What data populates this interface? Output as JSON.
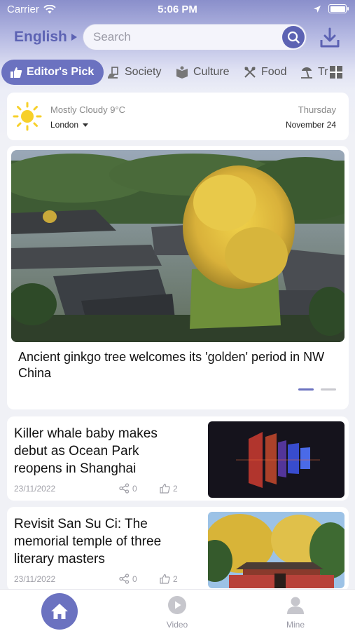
{
  "status_bar": {
    "carrier": "Carrier",
    "time": "5:06 PM"
  },
  "header": {
    "language": "English",
    "search_placeholder": "Search"
  },
  "tabs": [
    {
      "label": "Editor's Pick",
      "icon": "thumbs-up-icon",
      "active": true
    },
    {
      "label": "Society",
      "icon": "society-icon"
    },
    {
      "label": "Culture",
      "icon": "culture-icon"
    },
    {
      "label": "Food",
      "icon": "food-icon"
    },
    {
      "label": "Tr",
      "icon": "travel-icon"
    }
  ],
  "weather": {
    "condition": "Mostly Cloudy 9°C",
    "city": "London",
    "day": "Thursday",
    "date": "November 24",
    "icon": "sun-icon"
  },
  "feature": {
    "headline": "Ancient ginkgo tree welcomes its 'golden' period in NW China",
    "slides": 2,
    "active_slide": 1
  },
  "articles": [
    {
      "title": "Killer whale baby makes debut as Ocean Park reopens in Shanghai",
      "date": "23/11/2022",
      "shares": "0",
      "likes": "2"
    },
    {
      "title": "Revisit San Su Ci: The memorial temple of three literary masters",
      "date": "23/11/2022",
      "shares": "0",
      "likes": "2"
    }
  ],
  "bottom_nav": {
    "home": "",
    "video": "Video",
    "mine": "Mine"
  },
  "colors": {
    "accent": "#6b72c0",
    "accent_dark": "#5c62b3"
  }
}
